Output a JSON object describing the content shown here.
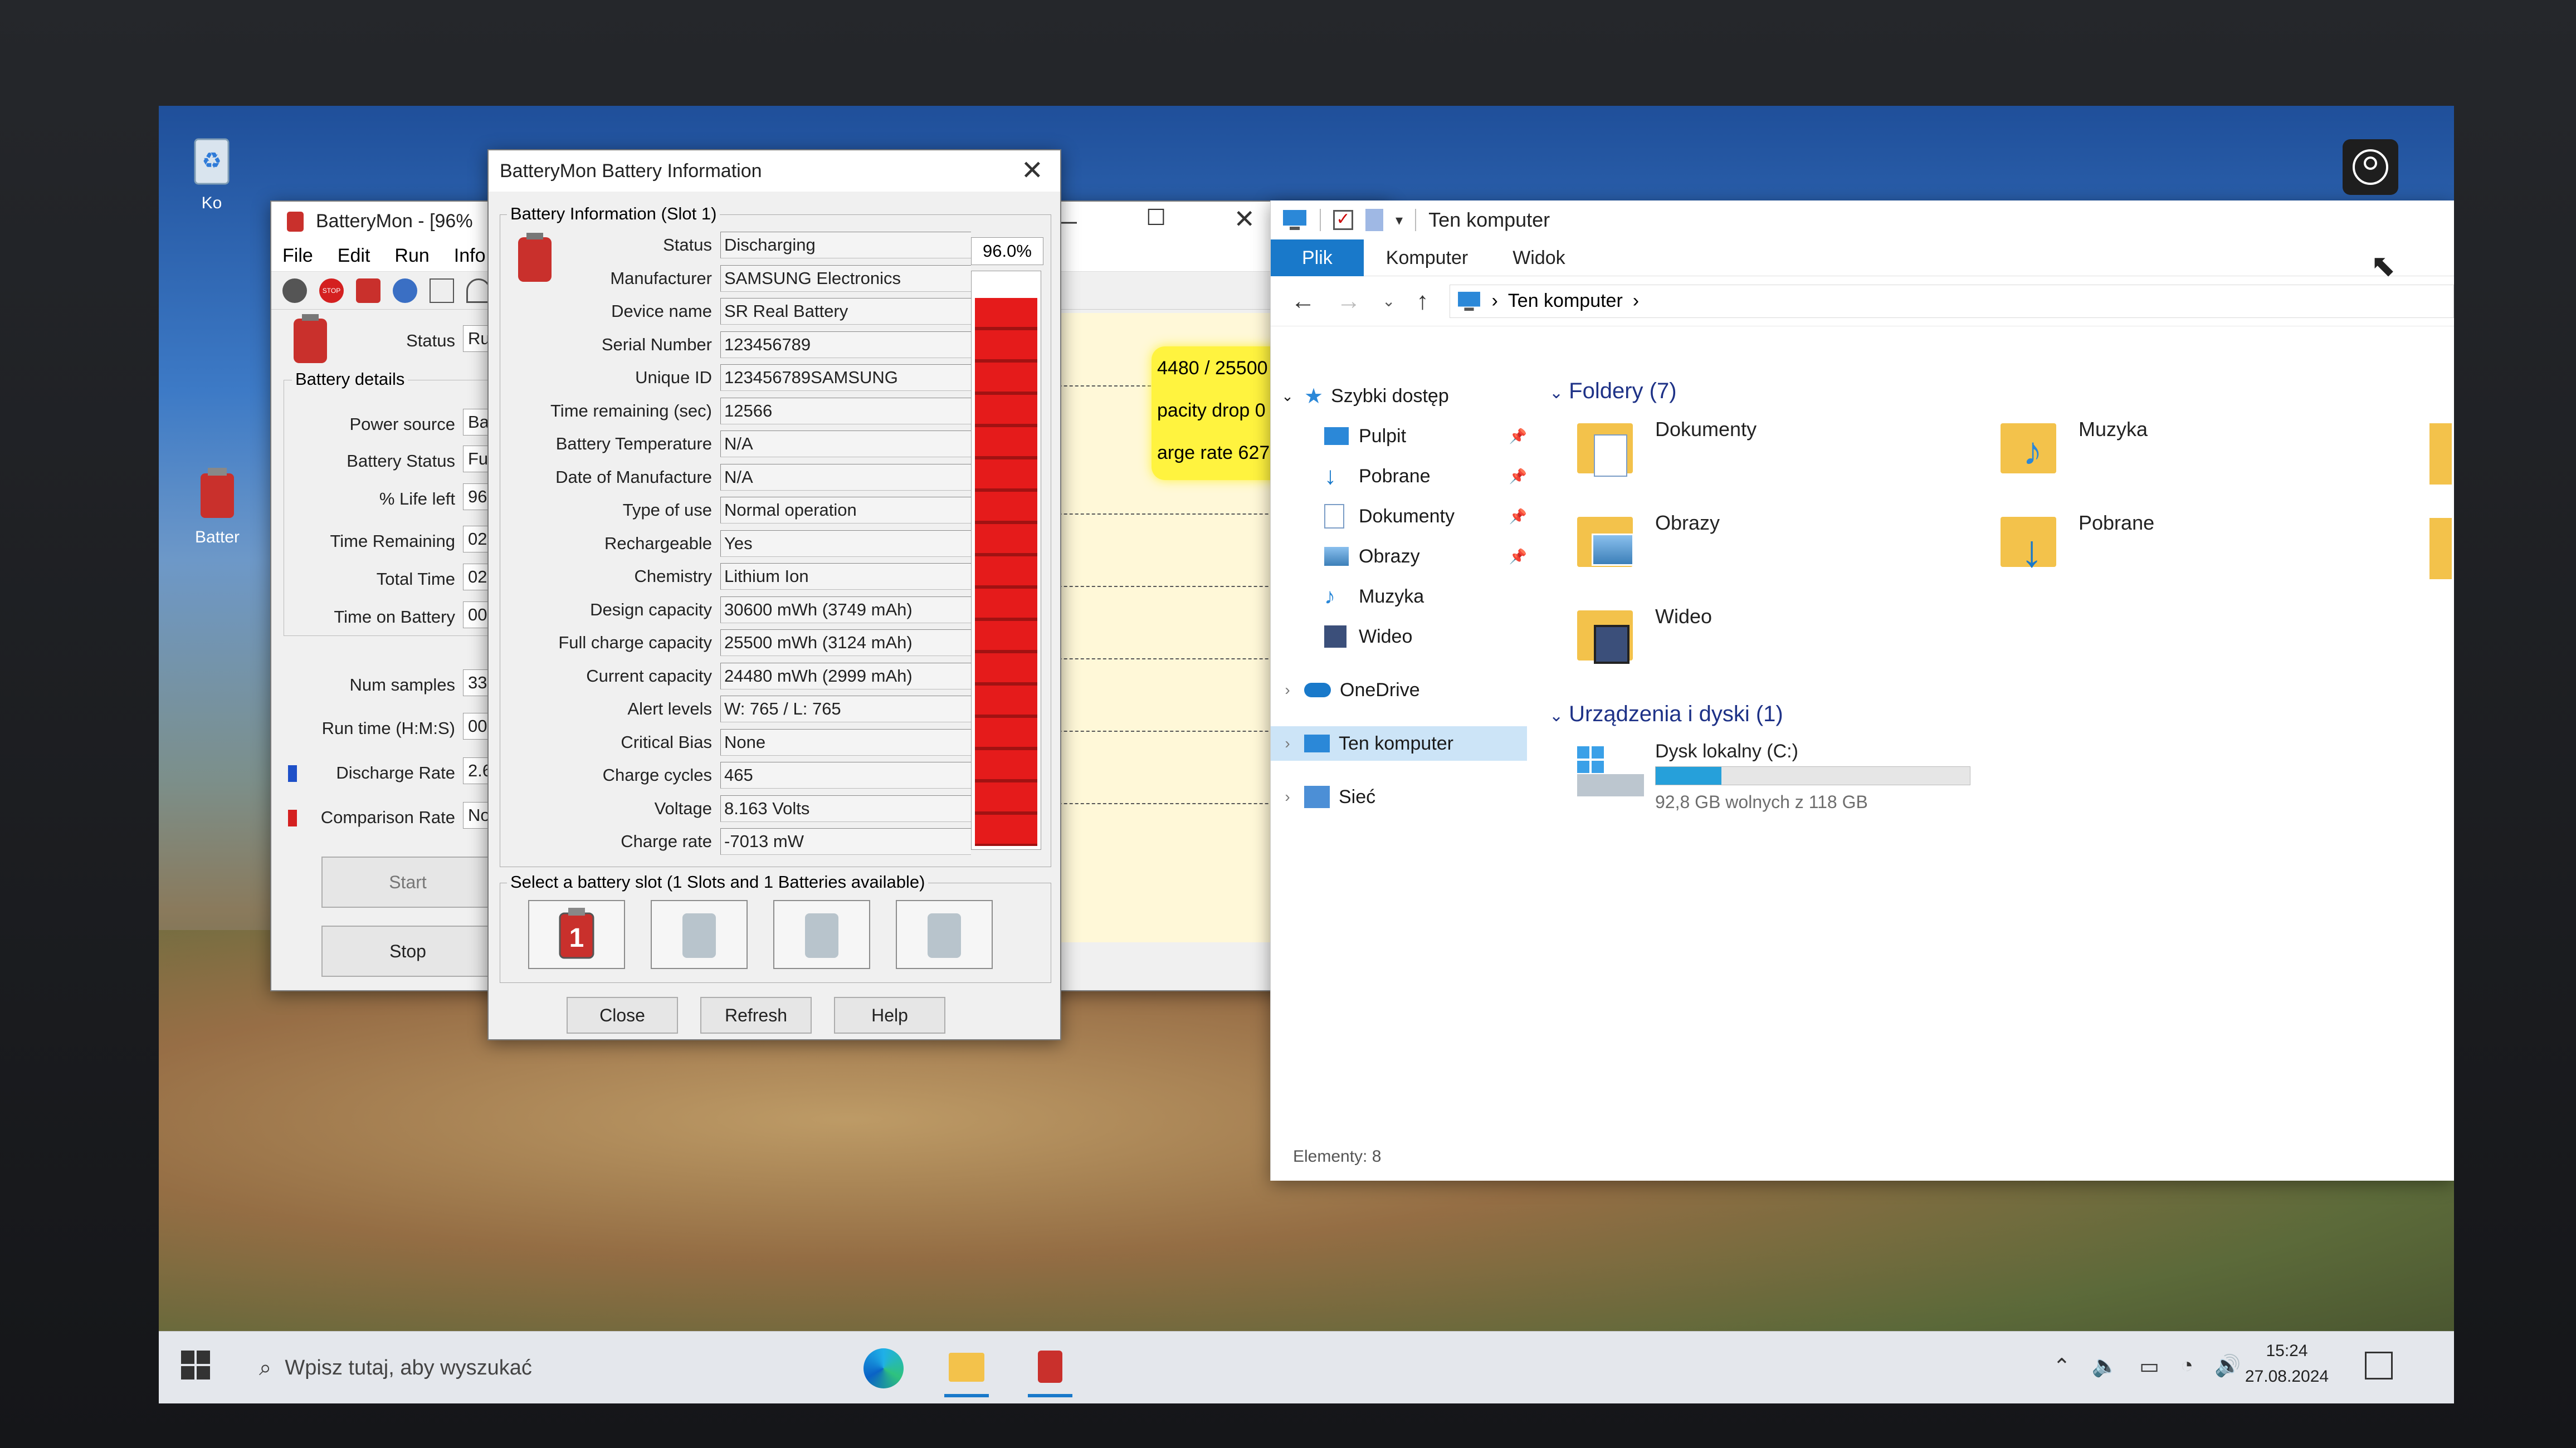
{
  "desktop": {
    "icons": [
      {
        "label": "Ko"
      },
      {
        "label": "Batter"
      }
    ]
  },
  "batterymon": {
    "title": "BatteryMon - [96%",
    "menu": [
      "File",
      "Edit",
      "Run",
      "Info"
    ],
    "status_label": "Status",
    "status_value": "Ru",
    "group_title": "Battery details",
    "fields": [
      {
        "label": "Power source",
        "value": "Bat"
      },
      {
        "label": "Battery Status",
        "value": "Ful"
      },
      {
        "label": "% Life left",
        "value": "96"
      },
      {
        "label": "Time Remaining",
        "value": "02:"
      },
      {
        "label": "Total Time",
        "value": "02:"
      },
      {
        "label": "Time on Battery",
        "value": "00:"
      }
    ],
    "stats": [
      {
        "label": "Num samples",
        "value": "33"
      },
      {
        "label": "Run time (H:M:S)",
        "value": "00:"
      },
      {
        "label": "Discharge Rate",
        "value": "2.6"
      },
      {
        "label": "Comparison Rate",
        "value": "No"
      }
    ],
    "start_label": "Start",
    "stop_label": "Stop",
    "graph_texts": [
      "4480 / 25500 mWh",
      "pacity drop 0 mWh",
      "arge rate 6278 mW"
    ]
  },
  "info": {
    "title": "BatteryMon Battery Information",
    "group_title": "Battery Information (Slot 1)",
    "percent": "96.0%",
    "percent_fraction": 0.96,
    "rows": [
      {
        "label": "Status",
        "value": "Discharging"
      },
      {
        "label": "Manufacturer",
        "value": "SAMSUNG Electronics"
      },
      {
        "label": "Device name",
        "value": "SR Real Battery"
      },
      {
        "label": "Serial Number",
        "value": "123456789"
      },
      {
        "label": "Unique ID",
        "value": "123456789SAMSUNG"
      },
      {
        "label": "Time remaining (sec)",
        "value": "12566"
      },
      {
        "label": "Battery Temperature",
        "value": "N/A"
      },
      {
        "label": "Date of Manufacture",
        "value": "N/A"
      },
      {
        "label": "Type of use",
        "value": "Normal operation"
      },
      {
        "label": "Rechargeable",
        "value": "Yes"
      },
      {
        "label": "Chemistry",
        "value": "Lithium Ion"
      },
      {
        "label": "Design capacity",
        "value": "30600 mWh (3749 mAh)"
      },
      {
        "label": "Full charge capacity",
        "value": "25500 mWh (3124 mAh)"
      },
      {
        "label": "Current capacity",
        "value": "24480 mWh (2999 mAh)"
      },
      {
        "label": "Alert levels",
        "value": "W: 765 / L: 765"
      },
      {
        "label": "Critical Bias",
        "value": "None"
      },
      {
        "label": "Charge cycles",
        "value": "465"
      },
      {
        "label": "Voltage",
        "value": "8.163 Volts"
      },
      {
        "label": "Charge rate",
        "value": "-7013 mW"
      }
    ],
    "slot_group_title": "Select a battery slot (1 Slots and 1 Batteries available)",
    "slot_number": "1",
    "close_label": "Close",
    "refresh_label": "Refresh",
    "help_label": "Help"
  },
  "explorer": {
    "title": "Ten komputer",
    "tabs": [
      "Plik",
      "Komputer",
      "Widok"
    ],
    "address": "Ten komputer",
    "nav": {
      "quick": "Szybki dostęp",
      "quick_items": [
        "Pulpit",
        "Pobrane",
        "Dokumenty",
        "Obrazy",
        "Muzyka",
        "Wideo"
      ],
      "onedrive": "OneDrive",
      "thispc": "Ten komputer",
      "network": "Sieć"
    },
    "folders_header": "Foldery (7)",
    "folders": [
      "Dokumenty",
      "Muzyka",
      "Obrazy",
      "Pobrane",
      "Wideo"
    ],
    "devices_header": "Urządzenia i dyski (1)",
    "drive_name": "Dysk lokalny (C:)",
    "drive_free": "92,8 GB wolnych z 118 GB",
    "drive_used_fraction": 0.21,
    "status": "Elementy: 8"
  },
  "taskbar": {
    "search_placeholder": "Wpisz tutaj, aby wyszukać",
    "time": "15:24",
    "date": "27.08.2024"
  }
}
